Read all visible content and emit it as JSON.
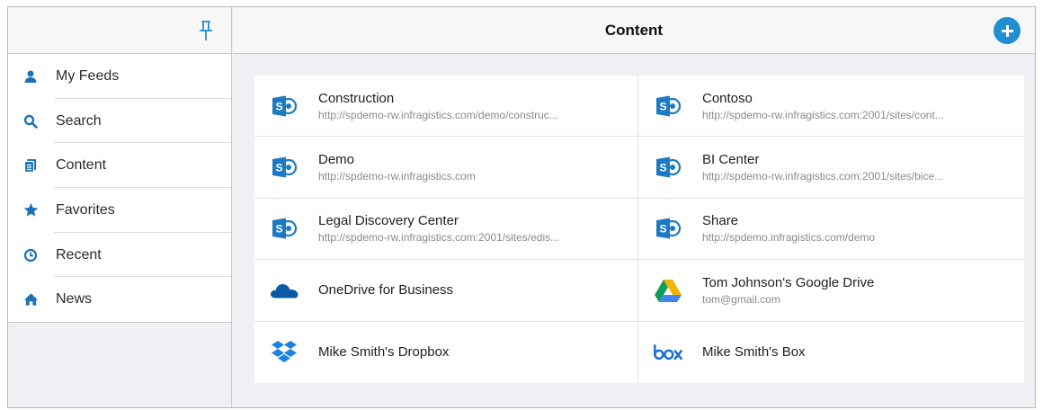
{
  "sidebar": {
    "pin_icon": "pin-icon",
    "items": [
      {
        "label": "My Feeds",
        "icon": "person-icon"
      },
      {
        "label": "Search",
        "icon": "search-icon"
      },
      {
        "label": "Content",
        "icon": "content-icon"
      },
      {
        "label": "Favorites",
        "icon": "star-icon"
      },
      {
        "label": "Recent",
        "icon": "clock-icon"
      },
      {
        "label": "News",
        "icon": "home-icon"
      }
    ]
  },
  "header": {
    "title": "Content",
    "add_icon": "plus-icon"
  },
  "tiles": [
    {
      "title": "Construction",
      "subtitle": "http://spdemo-rw.infragistics.com/demo/construc...",
      "icon": "sharepoint-icon"
    },
    {
      "title": "Contoso",
      "subtitle": "http://spdemo-rw.infragistics.com:2001/sites/cont...",
      "icon": "sharepoint-icon"
    },
    {
      "title": "Demo",
      "subtitle": "http://spdemo-rw.infragistics.com",
      "icon": "sharepoint-icon"
    },
    {
      "title": "BI Center",
      "subtitle": "http://spdemo-rw.infragistics.com:2001/sites/bice...",
      "icon": "sharepoint-icon"
    },
    {
      "title": "Legal Discovery Center",
      "subtitle": "http://spdemo-rw.infragistics.com:2001/sites/edis...",
      "icon": "sharepoint-icon"
    },
    {
      "title": "Share",
      "subtitle": "http://spdemo.infragistics.com/demo",
      "icon": "sharepoint-icon"
    },
    {
      "title": "OneDrive for Business",
      "subtitle": "",
      "icon": "onedrive-icon"
    },
    {
      "title": "Tom Johnson's Google Drive",
      "subtitle": "tom@gmail.com",
      "icon": "google-drive-icon"
    },
    {
      "title": "Mike Smith's Dropbox",
      "subtitle": "",
      "icon": "dropbox-icon"
    },
    {
      "title": "Mike Smith's Box",
      "subtitle": "",
      "icon": "box-icon"
    }
  ],
  "colors": {
    "accent": "#1f8fd2",
    "sharepoint": "#1b7ac2",
    "onedrive": "#0b5aa8",
    "dropbox": "#1a82e2",
    "box": "#1a6fcf"
  }
}
